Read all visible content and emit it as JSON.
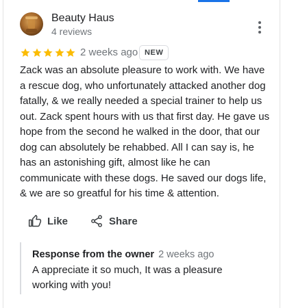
{
  "reviewer": {
    "name": "Beauty Haus",
    "reviews_count": "4 reviews",
    "avatar": "avatar-photo"
  },
  "review": {
    "rating": 5,
    "rating_max": 5,
    "date": "2 weeks ago",
    "badge": "NEW",
    "text": "Zack was an absolute pleasure to work with. We have a rescue dog, who unfortunately attacked another dog fatally, & we really needed a special trainer to help us out. Zack spent hours with us that first day. He gave us hope from the second he walked in the door, that our dog can absolutely be rehabbed. All I can say is, he has an astonishing gift, almost like he can communicate with these dogs. He saved our dogs life, & we are so greatful for his time & attention."
  },
  "actions": {
    "like_label": "Like",
    "like_icon": "thumbs-up-icon",
    "share_label": "Share",
    "share_icon": "share-icon",
    "menu_icon": "more-vert-icon"
  },
  "owner_response": {
    "title": "Response from the owner",
    "date": "2 weeks ago",
    "text": "A appreciate it so much, It was a pleasure working with you!"
  },
  "colors": {
    "star": "#fbbc04",
    "accent": "#1a73e8",
    "secondary_text": "#70757a"
  }
}
